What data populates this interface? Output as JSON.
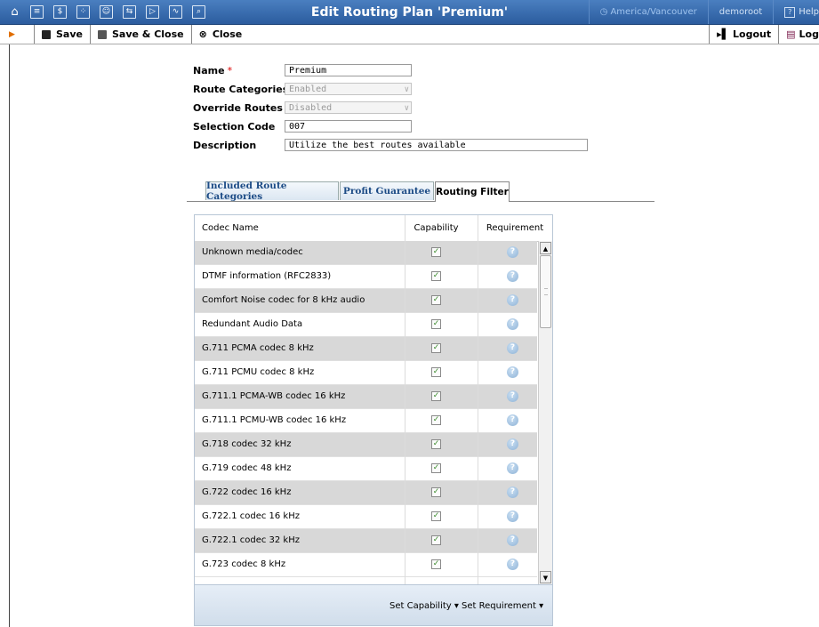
{
  "header": {
    "title": "Edit Routing Plan 'Premium'",
    "timezone": "America/Vancouver",
    "user": "demoroot",
    "help": "Help"
  },
  "toolbar": {
    "save": "Save",
    "save_close": "Save & Close",
    "close": "Close",
    "logout": "Logout",
    "log": "Log"
  },
  "form": {
    "name_label": "Name",
    "name_value": "Premium",
    "route_categories_label": "Route Categories",
    "route_categories_value": "Enabled",
    "override_routes_label": "Override Routes",
    "override_routes_value": "Disabled",
    "selection_code_label": "Selection Code",
    "selection_code_value": "007",
    "description_label": "Description",
    "description_value": "Utilize the best routes available",
    "required_marker": "*"
  },
  "tabs": [
    "Included Route Categories",
    "Profit Guarantee",
    "Routing Filter"
  ],
  "grid": {
    "headers": {
      "codec": "Codec Name",
      "capability": "Capability",
      "requirement": "Requirement"
    },
    "rows": [
      "Unknown media/codec",
      "DTMF information (RFC2833)",
      "Comfort Noise codec for 8 kHz audio",
      "Redundant Audio Data",
      "G.711 PCMA codec 8 kHz",
      "G.711 PCMU codec 8 kHz",
      "G.711.1 PCMA-WB codec 16 kHz",
      "G.711.1 PCMU-WB codec 16 kHz",
      "G.718 codec 32 kHz",
      "G.719 codec 48 kHz",
      "G.722 codec 16 kHz",
      "G.722.1 codec 16 kHz",
      "G.722.1 codec 32 kHz",
      "G.723 codec 8 kHz"
    ],
    "footer": {
      "set_capability": "Set Capability ▾",
      "set_requirement": "Set Requirement ▾"
    }
  }
}
